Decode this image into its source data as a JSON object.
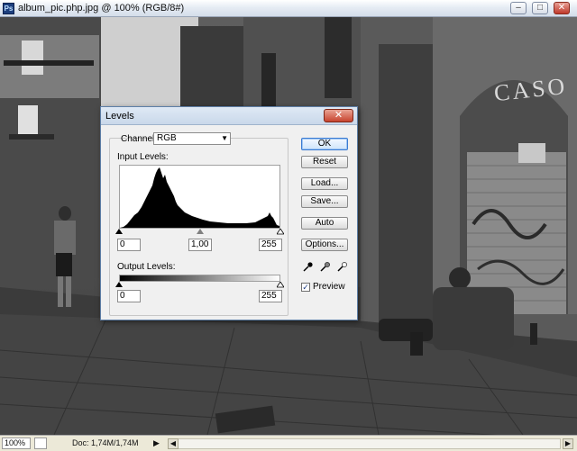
{
  "window": {
    "title": "album_pic.php.jpg @ 100% (RGB/8#)",
    "app_icon": "Ps",
    "buttons": {
      "minimize": "–",
      "maximize": "□",
      "close": "✕"
    }
  },
  "photo": {
    "sign_text": "CASO"
  },
  "levels_dialog": {
    "title": "Levels",
    "close_glyph": "✕",
    "channel_label": "Channel:",
    "channel_value": "RGB",
    "input_levels_label": "Input Levels:",
    "input_black": "0",
    "input_gamma": "1,00",
    "input_white": "255",
    "output_levels_label": "Output Levels:",
    "output_black": "0",
    "output_white": "255",
    "buttons": {
      "ok": "OK",
      "reset": "Reset",
      "load": "Load...",
      "save": "Save...",
      "auto": "Auto",
      "options": "Options..."
    },
    "preview_label": "Preview",
    "preview_checked": true,
    "preview_check_glyph": "✓",
    "eyedroppers": [
      "black-eyedropper-icon",
      "gray-eyedropper-icon",
      "white-eyedropper-icon"
    ]
  },
  "statusbar": {
    "zoom": "100%",
    "doc_info": "Doc: 1,74M/1,74M",
    "arrow": "▶",
    "scroll_left": "◀",
    "scroll_right": "▶"
  }
}
